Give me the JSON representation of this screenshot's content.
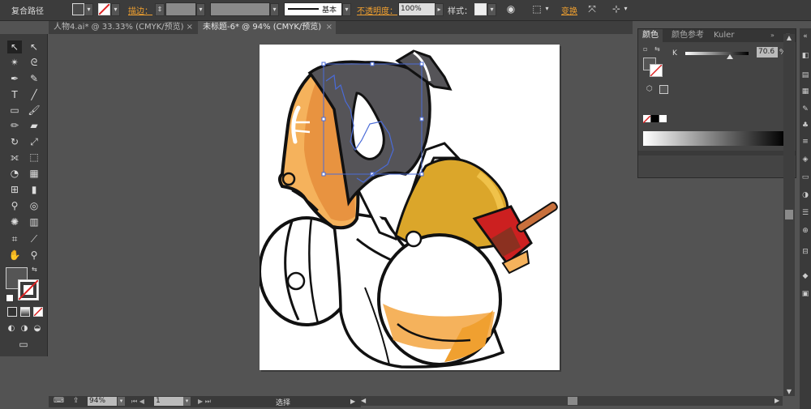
{
  "control_bar": {
    "object_type": "复合路径",
    "stroke_label": "描边：",
    "stroke_profile": "基本",
    "opacity_label": "不透明度：",
    "opacity_value": "100%",
    "style_label": "样式：",
    "transform_label": "变换"
  },
  "tabs": [
    {
      "label": "人物4.ai* @ 33.33% (CMYK/预览)",
      "close": "×"
    },
    {
      "label": "未标题-6* @ 94% (CMYK/预览)",
      "close": "×"
    }
  ],
  "color_panel": {
    "tabs": [
      "颜色",
      "颜色参考",
      "Kuler"
    ],
    "channel_label": "K",
    "channel_value": "70.6",
    "percent": "%",
    "slider_fraction": 0.706
  },
  "status_bar": {
    "zoom": "94%",
    "artboard_number": "1",
    "tool_label": "选择"
  },
  "colors": {
    "skin": "#F5B25C",
    "skin_shadow": "#E89340",
    "hair": "#555458",
    "robe_yellow": "#DBA62A",
    "armband": "#CC2020",
    "stick": "#C8703C",
    "selection": "#4A6BD8"
  }
}
